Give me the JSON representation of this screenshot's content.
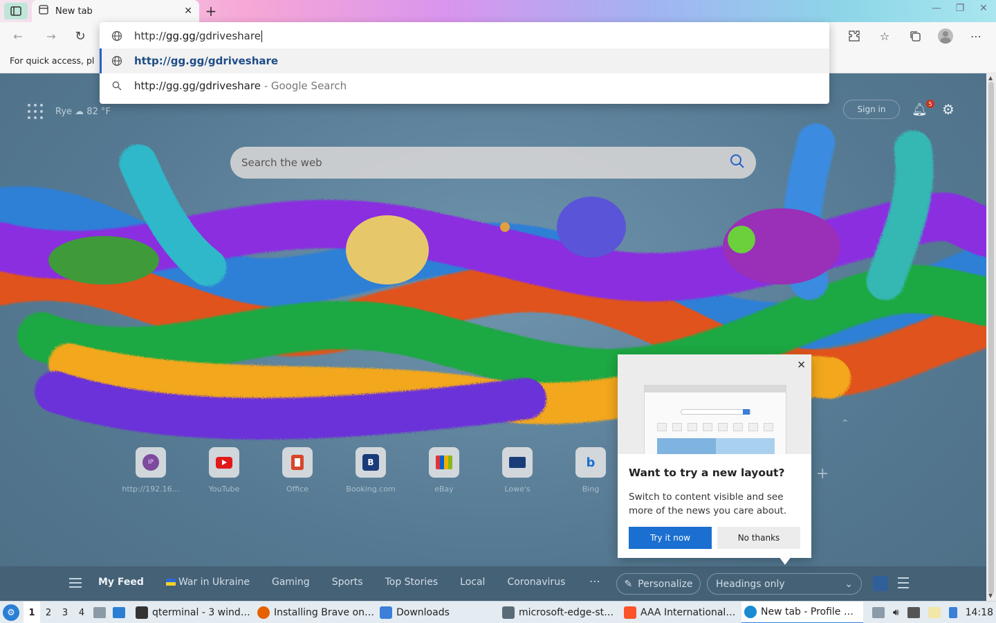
{
  "tab": {
    "title": "New tab"
  },
  "address": {
    "typed_prefix": "http://",
    "typed_host": "gg.gg",
    "typed_path": "/gdriveshare",
    "suggestion_url": "http://gg.gg/gdriveshare",
    "search_query": "http://gg.gg/gdriveshare",
    "search_suffix": " - Google Search"
  },
  "favbar": {
    "text": "For quick access, pl"
  },
  "newtab": {
    "location": "Rye",
    "temperature": "82 °F",
    "signin": "Sign in",
    "notification_count": "5",
    "search_placeholder": "Search the web",
    "quick_links": [
      {
        "label": "http://192.16…",
        "icon": "ip-icon",
        "glyph": "IP"
      },
      {
        "label": "YouTube",
        "icon": "youtube-icon"
      },
      {
        "label": "Office",
        "icon": "office-icon"
      },
      {
        "label": "Booking.com",
        "icon": "booking-icon",
        "glyph": "B"
      },
      {
        "label": "eBay",
        "icon": "ebay-icon"
      },
      {
        "label": "Lowe's",
        "icon": "lowes-icon"
      },
      {
        "label": "Bing",
        "icon": "bing-icon",
        "glyph": "b"
      }
    ]
  },
  "popup": {
    "title": "Want to try a new layout?",
    "body": "Switch to content visible and see more of the news you care about.",
    "try_label": "Try it now",
    "no_label": "No thanks"
  },
  "feed": {
    "tabs": [
      "My Feed",
      "War in Ukraine",
      "Gaming",
      "Sports",
      "Top Stories",
      "Local",
      "Coronavirus"
    ],
    "personalize": "Personalize",
    "layout_option": "Headings only"
  },
  "taskbar": {
    "workspaces": [
      "1",
      "2",
      "3",
      "4"
    ],
    "tasks": [
      {
        "label": "qterminal - 3 wind…",
        "color": "#333333"
      },
      {
        "label": "Installing Brave on…",
        "color": "#e66000"
      },
      {
        "label": "Downloads",
        "color": "#3b7fd6"
      },
      {
        "label": "microsoft-edge-st…",
        "color": "#5a6b78"
      },
      {
        "label": "AAA International…",
        "color": "#fb542b"
      },
      {
        "label": "New tab - Profile …",
        "color": "#1a8ad1"
      }
    ],
    "clock": "14:18"
  },
  "colors": {
    "accent": "#1a6fd0",
    "selection_bar": "#2560c6"
  }
}
